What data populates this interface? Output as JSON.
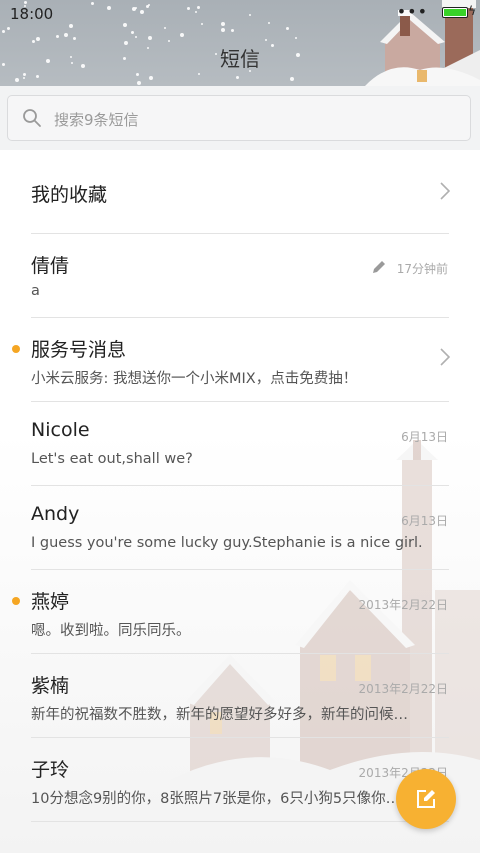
{
  "status_bar": {
    "time": "18:00",
    "dots": "•••"
  },
  "header": {
    "title": "短信"
  },
  "search": {
    "placeholder": "搜索9条短信"
  },
  "favorites": {
    "label": "我的收藏"
  },
  "conversations": [
    {
      "name": "倩倩",
      "preview": "a",
      "time": "17分钟前",
      "unread": false,
      "draft": true
    },
    {
      "name": "服务号消息",
      "preview": "小米云服务: 我想送你一个小米MIX，点击免费抽！",
      "time": "",
      "unread": true,
      "draft": false
    },
    {
      "name": "Nicole",
      "preview": "Let's eat out,shall we?",
      "time": "6月13日",
      "unread": false,
      "draft": false
    },
    {
      "name": "Andy",
      "preview": "I guess you're some lucky guy.Stephanie is a nice girl.",
      "time": "6月13日",
      "unread": false,
      "draft": false
    },
    {
      "name": "燕婷",
      "preview": "嗯。收到啦。同乐同乐。",
      "time": "2013年2月22日",
      "unread": true,
      "draft": false
    },
    {
      "name": "紫楠",
      "preview": "新年的祝福数不胜数，新年的愿望好多好多，新年的问候…",
      "time": "2013年2月22日",
      "unread": false,
      "draft": false
    },
    {
      "name": "子玲",
      "preview": "10分想念9别的你，8张照片7张是你，6只小狗5只像你…",
      "time": "2013年2月22日",
      "unread": false,
      "draft": false
    }
  ],
  "colors": {
    "accent": "#f7b132",
    "unread": "#f5a623",
    "battery": "#39d228"
  },
  "icons": {
    "compose": "compose-icon",
    "search": "search-icon",
    "chevron": "chevron-right-icon"
  }
}
